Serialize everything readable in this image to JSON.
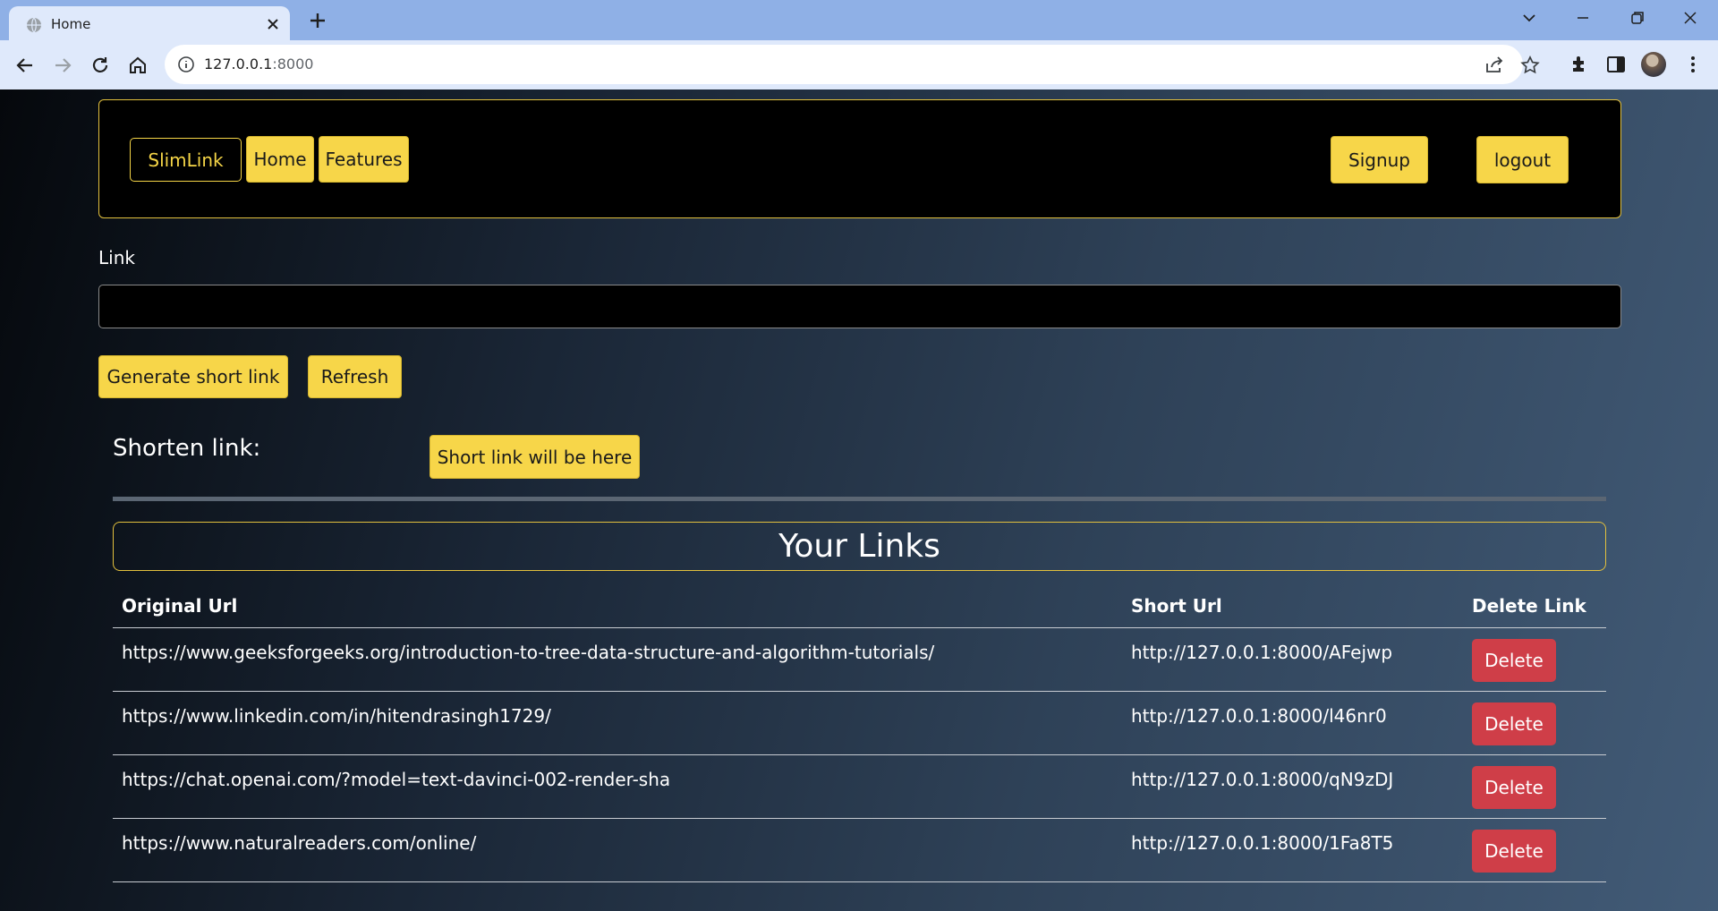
{
  "browser": {
    "tab_title": "Home",
    "url_host": "127.0.0.1",
    "url_port": ":8000"
  },
  "navbar": {
    "brand": "SlimLink",
    "home": "Home",
    "features": "Features",
    "signup": "Signup",
    "logout": "logout"
  },
  "form": {
    "link_label": "Link",
    "link_value": "",
    "generate_label": "Generate short link",
    "refresh_label": "Refresh",
    "shorten_label": "Shorten link:",
    "short_link_placeholder": "Short link will be here"
  },
  "links_section": {
    "title": "Your Links",
    "columns": [
      "Original Url",
      "Short Url",
      "Delete Link"
    ],
    "rows": [
      {
        "original": "https://www.geeksforgeeks.org/introduction-to-tree-data-structure-and-algorithm-tutorials/",
        "short": "http://127.0.0.1:8000/AFejwp",
        "action": "Delete"
      },
      {
        "original": "https://www.linkedin.com/in/hitendrasingh1729/",
        "short": "http://127.0.0.1:8000/l46nr0",
        "action": "Delete"
      },
      {
        "original": "https://chat.openai.com/?model=text-davinci-002-render-sha",
        "short": "http://127.0.0.1:8000/qN9zDJ",
        "action": "Delete"
      },
      {
        "original": "https://www.naturalreaders.com/online/",
        "short": "http://127.0.0.1:8000/1Fa8T5",
        "action": "Delete"
      }
    ]
  },
  "colors": {
    "accent_yellow": "#f7d649",
    "danger_red": "#cf3e48",
    "navbar_border": "#e2c03d"
  }
}
